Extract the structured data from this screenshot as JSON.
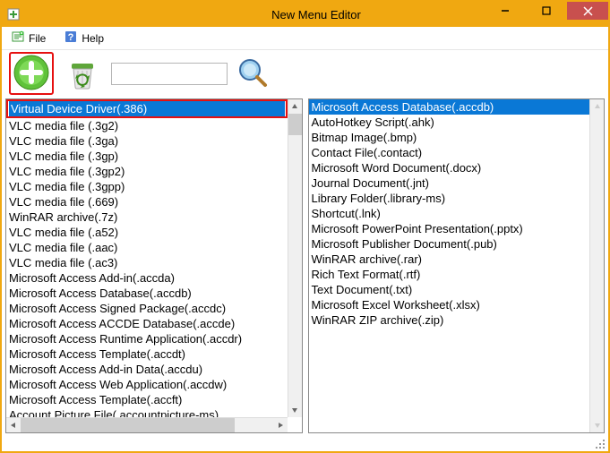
{
  "window": {
    "title": "New Menu Editor"
  },
  "menubar": {
    "file_label": "File",
    "help_label": "Help"
  },
  "search": {
    "value": "",
    "placeholder": ""
  },
  "left_list": {
    "selected_index": 0,
    "items": [
      "Virtual Device Driver(.386)",
      "VLC media file (.3g2)",
      "VLC media file (.3ga)",
      "VLC media file (.3gp)",
      "VLC media file (.3gp2)",
      "VLC media file (.3gpp)",
      "VLC media file (.669)",
      "WinRAR archive(.7z)",
      "VLC media file (.a52)",
      "VLC media file (.aac)",
      "VLC media file (.ac3)",
      "Microsoft Access Add-in(.accda)",
      "Microsoft Access Database(.accdb)",
      "Microsoft Access Signed Package(.accdc)",
      "Microsoft Access ACCDE Database(.accde)",
      "Microsoft Access Runtime Application(.accdr)",
      "Microsoft Access Template(.accdt)",
      "Microsoft Access Add-in Data(.accdu)",
      "Microsoft Access Web Application(.accdw)",
      "Microsoft Access Template(.accft)",
      "Account Picture File(.accountpicture-ms)"
    ]
  },
  "right_list": {
    "selected_index": 0,
    "items": [
      "Microsoft Access Database(.accdb)",
      "AutoHotkey Script(.ahk)",
      "Bitmap Image(.bmp)",
      "Contact File(.contact)",
      "Microsoft Word Document(.docx)",
      "Journal Document(.jnt)",
      "Library Folder(.library-ms)",
      "Shortcut(.lnk)",
      "Microsoft PowerPoint Presentation(.pptx)",
      "Microsoft Publisher Document(.pub)",
      "WinRAR archive(.rar)",
      "Rich Text Format(.rtf)",
      "Text Document(.txt)",
      "Microsoft Excel Worksheet(.xlsx)",
      "WinRAR ZIP archive(.zip)"
    ]
  }
}
